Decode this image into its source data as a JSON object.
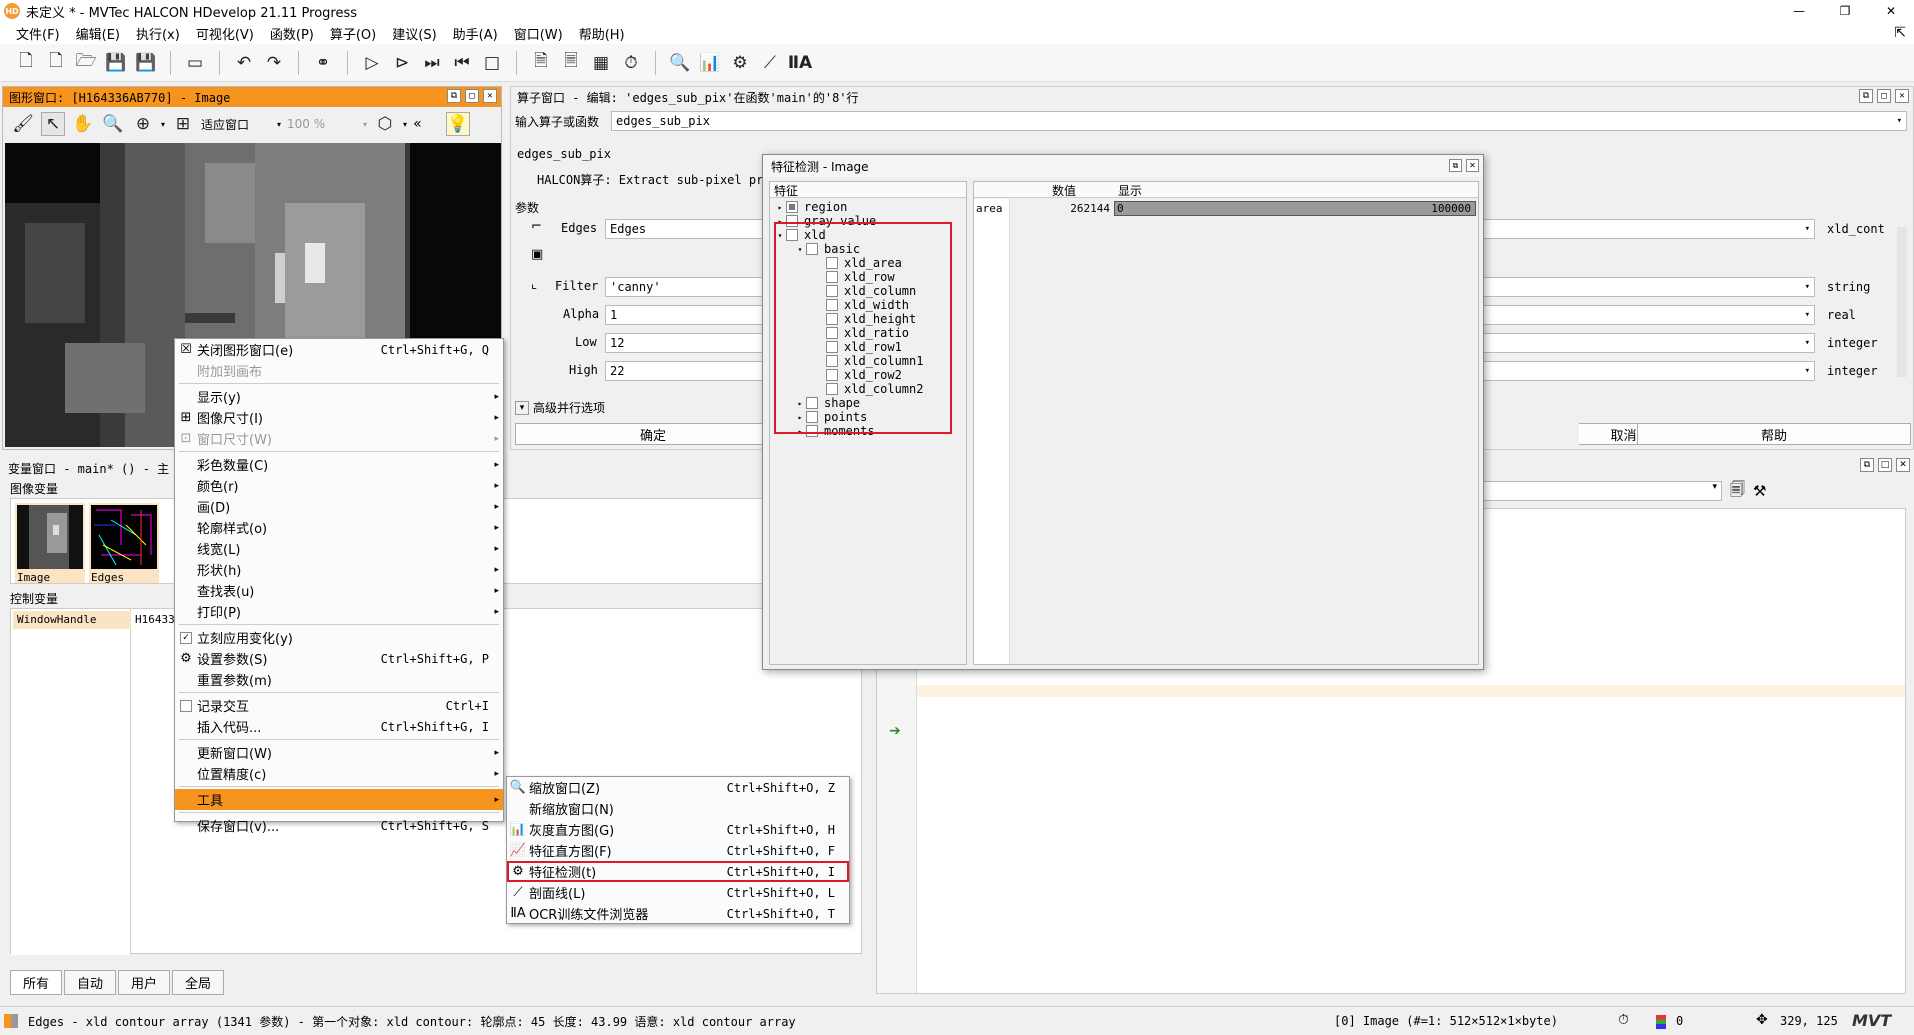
{
  "window": {
    "title": "未定义 * - MVTec HALCON HDevelop 21.11 Progress",
    "icon": "HD"
  },
  "menu": [
    "文件(F)",
    "编辑(E)",
    "执行(x)",
    "可视化(V)",
    "函数(P)",
    "算子(O)",
    "建议(S)",
    "助手(A)",
    "窗口(W)",
    "帮助(H)"
  ],
  "graphics_window": {
    "title": "图形窗口: [H164336AB770] - Image",
    "fit_label": "适应窗口",
    "zoom_value": "100 %"
  },
  "operator_window": {
    "title": "算子窗口 - 编辑: 'edges_sub_pix'在函数'main'的'8'行",
    "input_label": "输入算子或函数",
    "input_value": "edges_sub_pix",
    "op_name": "edges_sub_pix",
    "op_desc": "HALCON算子: Extract sub-pixel pr",
    "params_label": "参数",
    "params": [
      {
        "name": "Edges",
        "value": "Edges",
        "type": "xld_cont"
      },
      {
        "name": "Filter",
        "value": "'canny'",
        "type": "string"
      },
      {
        "name": "Alpha",
        "value": "1",
        "type": "real"
      },
      {
        "name": "Low",
        "value": "12",
        "type": "integer"
      },
      {
        "name": "High",
        "value": "22",
        "type": "integer"
      }
    ],
    "advanced": "高级并行选项",
    "ok": "确定",
    "cancel": "取消",
    "help": "帮助"
  },
  "variable_window": {
    "title": "变量窗口 - main* () - 主",
    "image_vars_label": "图像变量",
    "images": [
      {
        "name": "Image"
      },
      {
        "name": "Edges"
      }
    ],
    "control_vars_label": "控制变量",
    "controls": [
      {
        "name": "WindowHandle",
        "value": "H16433"
      }
    ],
    "tabs": [
      "所有",
      "自动",
      "用户",
      "全局"
    ]
  },
  "context_menu": [
    {
      "label": "关闭图形窗口(e)",
      "shortcut": "Ctrl+Shift+G, Q",
      "icon": "close-icon"
    },
    {
      "label": "附加到画布",
      "disabled": true
    },
    {
      "sep": true
    },
    {
      "label": "显示(y)",
      "sub": true
    },
    {
      "label": "图像尺寸(I)",
      "sub": true,
      "icon": "image-size-icon"
    },
    {
      "label": "窗口尺寸(W)",
      "sub": true,
      "disabled": true,
      "icon": "window-size-icon"
    },
    {
      "sep": true
    },
    {
      "label": "彩色数量(C)",
      "sub": true
    },
    {
      "label": "颜色(r)",
      "sub": true
    },
    {
      "label": "画(D)",
      "sub": true
    },
    {
      "label": "轮廓样式(o)",
      "sub": true
    },
    {
      "label": "线宽(L)",
      "sub": true
    },
    {
      "label": "形状(h)",
      "sub": true
    },
    {
      "label": "查找表(u)",
      "sub": true
    },
    {
      "label": "打印(P)",
      "sub": true
    },
    {
      "sep": true
    },
    {
      "label": "立刻应用变化(y)",
      "check": true
    },
    {
      "label": "设置参数(S)",
      "shortcut": "Ctrl+Shift+G, P",
      "icon": "gear-icon"
    },
    {
      "label": "重置参数(m)"
    },
    {
      "sep": true
    },
    {
      "label": "记录交互",
      "shortcut": "Ctrl+I",
      "checkbox": true
    },
    {
      "label": "插入代码...",
      "shortcut": "Ctrl+Shift+G, I"
    },
    {
      "sep": true
    },
    {
      "label": "更新窗口(W)",
      "sub": true
    },
    {
      "label": "位置精度(c)",
      "sub": true
    },
    {
      "sep": true
    },
    {
      "label": "工具",
      "sub": true,
      "highlight": true
    },
    {
      "sep": true
    },
    {
      "label": "保存窗口(v)...",
      "shortcut": "Ctrl+Shift+G, S"
    }
  ],
  "tools_submenu": [
    {
      "label": "缩放窗口(Z)",
      "shortcut": "Ctrl+Shift+O, Z",
      "icon": "zoom-icon"
    },
    {
      "label": "新缩放窗口(N)",
      "shortcut": ""
    },
    {
      "label": "灰度直方图(G)",
      "shortcut": "Ctrl+Shift+O, H",
      "icon": "histogram-icon"
    },
    {
      "label": "特征直方图(F)",
      "shortcut": "Ctrl+Shift+O, F",
      "icon": "feature-histogram-icon"
    },
    {
      "label": "特征检测(t)",
      "shortcut": "Ctrl+Shift+O, I",
      "icon": "feature-inspection-icon",
      "boxed": true
    },
    {
      "label": "剖面线(L)",
      "shortcut": "Ctrl+Shift+O, L",
      "icon": "line-profile-icon"
    },
    {
      "label": "OCR训练文件浏览器",
      "shortcut": "Ctrl+Shift+O, T",
      "icon": "ocr-icon"
    }
  ],
  "feature_dialog": {
    "title": "特征检测 - Image",
    "col_feature": "特征",
    "col_value": "数值",
    "col_display": "显示",
    "tree": [
      {
        "label": "region",
        "level": 0,
        "tri": "▸",
        "checked": true
      },
      {
        "label": "gray value",
        "level": 0,
        "tri": "▸"
      },
      {
        "label": "xld",
        "level": 0,
        "tri": "▾"
      },
      {
        "label": "basic",
        "level": 1,
        "tri": "▾"
      },
      {
        "label": "xld_area",
        "level": 2
      },
      {
        "label": "xld_row",
        "level": 2
      },
      {
        "label": "xld_column",
        "level": 2
      },
      {
        "label": "xld_width",
        "level": 2
      },
      {
        "label": "xld_height",
        "level": 2
      },
      {
        "label": "xld_ratio",
        "level": 2
      },
      {
        "label": "xld_row1",
        "level": 2
      },
      {
        "label": "xld_column1",
        "level": 2
      },
      {
        "label": "xld_row2",
        "level": 2
      },
      {
        "label": "xld_column2",
        "level": 2
      },
      {
        "label": "shape",
        "level": 1,
        "tri": "▸"
      },
      {
        "label": "points",
        "level": 1,
        "tri": "▸"
      },
      {
        "label": "moments",
        "level": 1,
        "tri": "▸"
      }
    ],
    "row": {
      "name": "area",
      "value": "262144",
      "min": "0",
      "max": "100000"
    }
  },
  "statusbar": {
    "message": "Edges - xld contour array (1341 参数) - 第一个对象: xld contour: 轮廓点: 45 长度: 43.99 语意: xld contour array",
    "image_info": "[0] Image (#=1: 512×512×1×byte)",
    "color_value": "0",
    "coords": "329, 125"
  },
  "colors": {
    "accent": "#f7941d",
    "highlight_box": "#e0182d"
  }
}
